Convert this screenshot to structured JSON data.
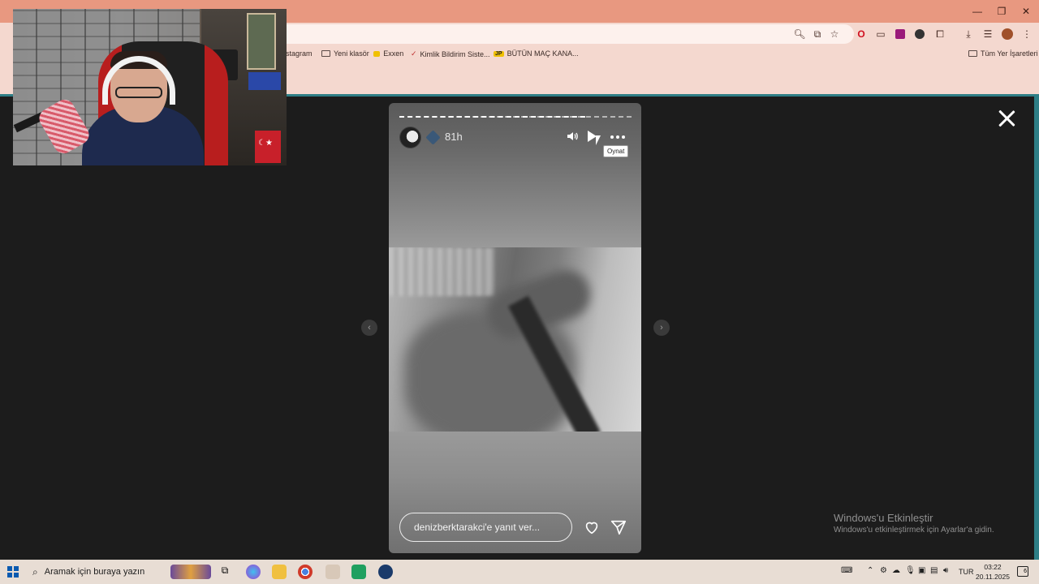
{
  "browser": {
    "bookmarks": [
      {
        "label": "stagram"
      },
      {
        "label": "Yeni klasör"
      },
      {
        "label": "Exxen"
      },
      {
        "label": "Kimlik Bildirim Siste..."
      },
      {
        "label": "BÜTÜN MAÇ KANA..."
      }
    ],
    "all_bookmarks_label": "Tüm Yer İşaretleri",
    "jp_badge": "JP"
  },
  "story": {
    "time_ago": "81h",
    "tooltip": "Oynat",
    "reply_placeholder": "denizberktarakci'e yanıt ver...",
    "progress_fraction": 0.8
  },
  "watermark": {
    "title": "Windows'u Etkinleştir",
    "subtitle": "Windows'u etkinleştirmek için Ayarlar'a gidin."
  },
  "taskbar": {
    "search_placeholder": "Aramak için buraya yazın",
    "language": "TUR",
    "time": "03:22",
    "date": "20.11.2025",
    "notification_count": "6"
  },
  "colors": {
    "accent_teal": "#2e7e86",
    "browser_frame": "#e89880",
    "viewer_bg": "#1c1c1c"
  }
}
